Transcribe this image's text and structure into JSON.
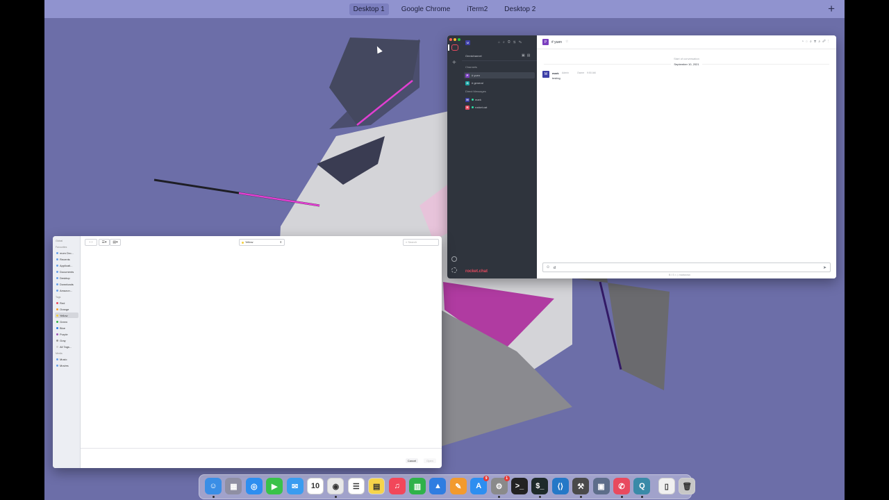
{
  "spaces": {
    "tabs": [
      "Desktop 1",
      "Google Chrome",
      "iTerm2",
      "Desktop 2"
    ],
    "active": "Desktop 1",
    "add_label": "+"
  },
  "rocketchat": {
    "sidebar": {
      "directory_label": "Omnichannel",
      "channels_label": "Channels",
      "direct_label": "Direct Messages",
      "channels": [
        {
          "avatar": "P",
          "name": "# yuen",
          "color": "#7b3fbf"
        },
        {
          "avatar": "G",
          "name": "# general",
          "color": "#1aa5a5"
        }
      ],
      "dms": [
        {
          "avatar": "M",
          "name": "mark",
          "color": "#3d3fa7"
        },
        {
          "avatar": "R",
          "name": "rocket.cat",
          "color": "#e84a5f"
        }
      ],
      "logo_text": "rocket.chat"
    },
    "header": {
      "avatar": "P",
      "room_name": "# yuen"
    },
    "conversation": {
      "start_label": "Start of conversation",
      "date_label": "September 10, 2021",
      "message": {
        "author": "mark",
        "role": "Admin",
        "role2": "Owner",
        "time": "9:50 AM",
        "text": "testing"
      }
    },
    "composer": {
      "value": "d"
    },
    "footer_hint": "markdown"
  },
  "finder": {
    "sidebar": {
      "device_label": "Global",
      "favorites_label": "Favourites",
      "favorites": [
        "mom Dro...",
        "Recents",
        "Applicati...",
        "Documents",
        "Desktop",
        "Downloads",
        "Amazon..."
      ],
      "tags_label": "Tags",
      "tags": [
        {
          "name": "Red",
          "color": "#e84a5f"
        },
        {
          "name": "Orange",
          "color": "#f39c2f"
        },
        {
          "name": "Yellow",
          "color": "#f4d03f"
        },
        {
          "name": "Green",
          "color": "#35b34a"
        },
        {
          "name": "Blue",
          "color": "#2f7de1"
        },
        {
          "name": "Purple",
          "color": "#9b59b6"
        },
        {
          "name": "Gray",
          "color": "#9a9a9a"
        },
        {
          "name": "All Tags...",
          "color": "#cfcfcf"
        }
      ],
      "media_label": "Media",
      "media": [
        "Music",
        "Movies"
      ]
    },
    "toolbar": {
      "location": "Yellow",
      "search_placeholder": "Search"
    },
    "buttons": {
      "cancel": "Cancel",
      "open": "Open"
    }
  },
  "dock": {
    "apps": [
      {
        "name": "Finder",
        "color": "#3a8ee6",
        "glyph": "☺",
        "running": true
      },
      {
        "name": "Launchpad",
        "color": "#8f8fa3",
        "glyph": "▦",
        "running": false
      },
      {
        "name": "Safari",
        "color": "#2d8ef0",
        "glyph": "◎",
        "running": false
      },
      {
        "name": "FaceTime",
        "color": "#39c24a",
        "glyph": "▶",
        "running": false
      },
      {
        "name": "Mail",
        "color": "#3a9cf0",
        "glyph": "✉",
        "running": false
      },
      {
        "name": "Calendar",
        "color": "#ffffff",
        "glyph": "10",
        "running": false
      },
      {
        "name": "Chrome",
        "color": "#e8e8e8",
        "glyph": "◉",
        "running": true
      },
      {
        "name": "Reminders",
        "color": "#ffffff",
        "glyph": "☰",
        "running": false
      },
      {
        "name": "Notes",
        "color": "#f6d44a",
        "glyph": "▤",
        "running": false
      },
      {
        "name": "Music",
        "color": "#f2475a",
        "glyph": "♫",
        "running": false
      },
      {
        "name": "Numbers",
        "color": "#2fb24a",
        "glyph": "▥",
        "running": false
      },
      {
        "name": "Keynote",
        "color": "#2f7de1",
        "glyph": "▲",
        "running": false
      },
      {
        "name": "Pages",
        "color": "#f29a2e",
        "glyph": "✎",
        "running": false
      },
      {
        "name": "App Store",
        "color": "#2d8ef0",
        "glyph": "A",
        "running": false,
        "badge": "9"
      },
      {
        "name": "System Preferences",
        "color": "#8a8a8a",
        "glyph": "⚙",
        "running": true,
        "badge": "1"
      },
      {
        "name": "Terminal",
        "color": "#222222",
        "glyph": ">_",
        "running": false
      },
      {
        "name": "iTerm2",
        "color": "#1e2a2a",
        "glyph": "$_",
        "running": true
      },
      {
        "name": "VS Code",
        "color": "#2478c7",
        "glyph": "⟨⟩",
        "running": false
      },
      {
        "name": "Xcode Tools",
        "color": "#4a4a4a",
        "glyph": "⚒",
        "running": true
      },
      {
        "name": "VirtualBox",
        "color": "#5d6d8a",
        "glyph": "▣",
        "running": false
      },
      {
        "name": "Rocket.Chat",
        "color": "#e84a5f",
        "glyph": "✆",
        "running": true
      },
      {
        "name": "QuickTime",
        "color": "#3a8aa8",
        "glyph": "Q",
        "running": true
      },
      {
        "name": "Documents",
        "color": "#f0f0f0",
        "glyph": "▯",
        "running": false
      },
      {
        "name": "Trash",
        "color": "#c7c7c7",
        "glyph": "🗑",
        "running": false
      }
    ]
  }
}
